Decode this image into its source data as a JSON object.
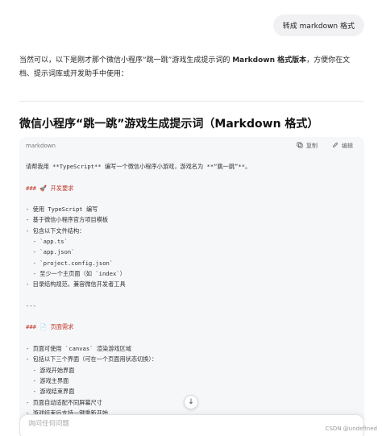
{
  "user_message": "转成 markdown 格式",
  "intro": {
    "before_bold": "当然可以，以下是刚才那个微信小程序“跳一跳”游戏生成提示词的 ",
    "bold": "Markdown 格式版本",
    "after_bold": "，方便你在文档、提示词库或开发助手中使用："
  },
  "heading": "微信小程序“跳一跳”游戏生成提示词（Markdown 格式）",
  "code": {
    "language": "markdown",
    "copy_label": "复制",
    "edit_label": "编辑",
    "lines": [
      {
        "text": "请帮我用 **TypeScript** 编写一个微信小程序小游戏，游戏名为 **“跳一跳”**。",
        "style": "normal"
      },
      {
        "text": "",
        "style": "normal"
      },
      {
        "text": "### 🚀 开发要求",
        "style": "red"
      },
      {
        "text": "",
        "style": "normal"
      },
      {
        "text": "- 使用 TypeScript 编写",
        "style": "normal"
      },
      {
        "text": "- 基于微信小程序官方项目模板",
        "style": "normal"
      },
      {
        "text": "- 包含以下文件结构：",
        "style": "normal"
      },
      {
        "text": "  - `app.ts`",
        "style": "normal"
      },
      {
        "text": "  - `app.json`",
        "style": "normal"
      },
      {
        "text": "  - `project.config.json`",
        "style": "normal"
      },
      {
        "text": "  - 至少一个主页面（如 `index`）",
        "style": "normal"
      },
      {
        "text": "- 目录结构规范，兼容微信开发者工具",
        "style": "normal"
      },
      {
        "text": "",
        "style": "normal"
      },
      {
        "text": "---",
        "style": "normal"
      },
      {
        "text": "",
        "style": "normal"
      },
      {
        "text": "### 📄 页面需求",
        "style": "red"
      },
      {
        "text": "",
        "style": "normal"
      },
      {
        "text": "- 页面可使用 `canvas` 渲染游戏区域",
        "style": "normal"
      },
      {
        "text": "- 包括以下三个界面（可在一个页面用状态切换）：",
        "style": "normal"
      },
      {
        "text": "  - 游戏开始界面",
        "style": "normal"
      },
      {
        "text": "  - 游戏主界面",
        "style": "normal"
      },
      {
        "text": "  - 游戏结束界面",
        "style": "normal"
      },
      {
        "text": "- 页面自动适配不同屏幕尺寸",
        "style": "normal"
      },
      {
        "text": "- 游戏结束后支持一键重新开始",
        "style": "normal"
      }
    ]
  },
  "input_placeholder": "询问任何问题",
  "watermark": "CSDN @undefined"
}
